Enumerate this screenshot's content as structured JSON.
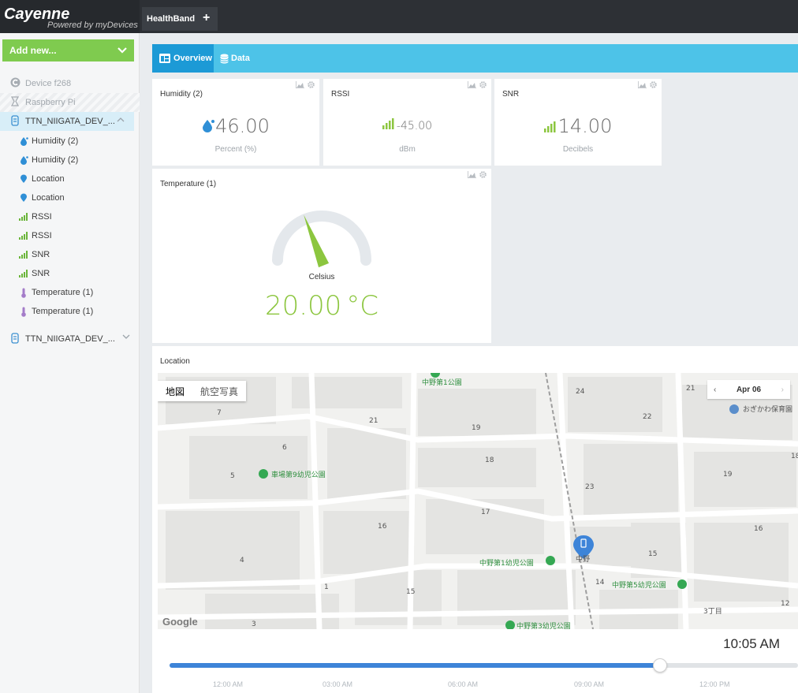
{
  "app": {
    "title": "Cayenne",
    "subtitle": "Powered by myDevices"
  },
  "top_tabs": [
    {
      "label": "HealthBand"
    }
  ],
  "add_tab_icon": "plus-icon",
  "sidebar": {
    "add_new_label": "Add new...",
    "devices": [
      {
        "label": "Device f268",
        "icon": "cayenne-icon"
      },
      {
        "label": "Raspberry Pi",
        "icon": "raspberry-icon"
      },
      {
        "label": "TTN_NIIGATA_DEV_...",
        "icon": "lora-icon",
        "expanded": true
      },
      {
        "label": "TTN_NIIGATA_DEV_...",
        "icon": "lora-icon",
        "expanded": false
      }
    ],
    "channels": [
      {
        "label": "Humidity (2)",
        "icon": "droplet-icon"
      },
      {
        "label": "Humidity (2)",
        "icon": "droplet-icon"
      },
      {
        "label": "Location",
        "icon": "map-pin-icon"
      },
      {
        "label": "Location",
        "icon": "map-pin-icon"
      },
      {
        "label": "RSSI",
        "icon": "signal-icon"
      },
      {
        "label": "RSSI",
        "icon": "signal-icon"
      },
      {
        "label": "SNR",
        "icon": "signal-icon"
      },
      {
        "label": "SNR",
        "icon": "signal-icon"
      },
      {
        "label": "Temperature (1)",
        "icon": "thermometer-icon"
      },
      {
        "label": "Temperature (1)",
        "icon": "thermometer-icon"
      }
    ]
  },
  "main_tabs": [
    {
      "label": "Overview",
      "icon": "dashboard-icon"
    },
    {
      "label": "Data",
      "icon": "database-icon"
    }
  ],
  "widgets": {
    "humidity": {
      "title": "Humidity (2)",
      "value": "46.00",
      "unit": "Percent (%)"
    },
    "rssi": {
      "title": "RSSI",
      "value": "-45.00",
      "unit": "dBm"
    },
    "snr": {
      "title": "SNR",
      "value": "14.00",
      "unit": "Decibels"
    },
    "temperature": {
      "title": "Temperature (1)",
      "value": "20.00",
      "unit_symbol": "°C",
      "gauge_label": "Celsius",
      "gauge_fraction": 0.38
    },
    "location": {
      "title": "Location",
      "map_type_buttons": [
        "地図",
        "航空写真"
      ],
      "date_label": "Apr 06",
      "time_label": "10:05 AM",
      "timeline_progress": 0.78,
      "timeline_ticks": [
        "12:00 AM",
        "03:00 AM",
        "06:00 AM",
        "09:00 AM",
        "12:00 PM"
      ],
      "map_labels": {
        "parks": [
          "中野第1公園",
          "車場第9幼児公園",
          "中野第1幼児公園",
          "中野第5幼児公園",
          "中野第3幼児公園"
        ],
        "places": [
          "おぎかわ保育園",
          "中野",
          "3丁目",
          "Google"
        ],
        "blocks": [
          "7",
          "21",
          "24",
          "21",
          "22",
          "19",
          "6",
          "18",
          "5",
          "23",
          "19",
          "17",
          "16",
          "16",
          "4",
          "1",
          "15",
          "14",
          "15",
          "12",
          "3",
          "18"
        ]
      },
      "colors": {
        "accent": "#3d84d8",
        "park": "#2f8f3f"
      }
    }
  },
  "colors": {
    "brand_green": "#7fcb4f",
    "tab_blue": "#4dc3e8",
    "tab_active": "#1c9ad6",
    "value_green": "#8cc63f"
  }
}
